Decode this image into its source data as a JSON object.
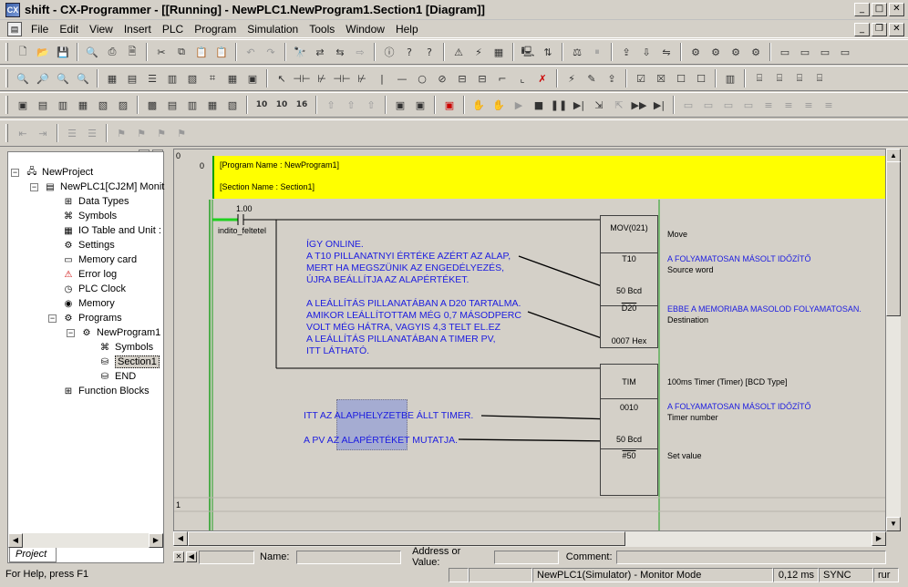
{
  "window": {
    "title": "shift - CX-Programmer - [[Running] - NewPLC1.NewProgram1.Section1 [Diagram]]"
  },
  "menu": [
    "File",
    "Edit",
    "View",
    "Insert",
    "PLC",
    "Program",
    "Simulation",
    "Tools",
    "Window",
    "Help"
  ],
  "tree": {
    "items": [
      {
        "label": "NewProject",
        "level": 0,
        "icon": "project-icon"
      },
      {
        "label": "NewPLC1[CJ2M] Monit",
        "level": 1,
        "icon": "plc-icon"
      },
      {
        "label": "Data Types",
        "level": 2,
        "icon": "datatypes-icon"
      },
      {
        "label": "Symbols",
        "level": 2,
        "icon": "symbols-icon"
      },
      {
        "label": "IO Table and Unit :",
        "level": 2,
        "icon": "iotable-icon"
      },
      {
        "label": "Settings",
        "level": 2,
        "icon": "settings-icon"
      },
      {
        "label": "Memory card",
        "level": 2,
        "icon": "memorycard-icon"
      },
      {
        "label": "Error log",
        "level": 2,
        "icon": "errorlog-icon"
      },
      {
        "label": "PLC Clock",
        "level": 2,
        "icon": "clock-icon"
      },
      {
        "label": "Memory",
        "level": 2,
        "icon": "memory-icon"
      },
      {
        "label": "Programs",
        "level": 2,
        "icon": "programs-icon"
      },
      {
        "label": "NewProgram1",
        "level": 3,
        "icon": "program-icon"
      },
      {
        "label": "Symbols",
        "level": 4,
        "icon": "symbols-icon"
      },
      {
        "label": "Section1",
        "level": 4,
        "icon": "section-icon"
      },
      {
        "label": "END",
        "level": 4,
        "icon": "section-icon"
      },
      {
        "label": "Function Blocks",
        "level": 2,
        "icon": "functionblocks-icon"
      }
    ],
    "tab": "Project"
  },
  "diagram": {
    "rung0_num": "0",
    "rung0_step": "0",
    "rung1_num": "1",
    "program_name": "[Program Name : NewProgram1]",
    "section_name": "[Section Name : Section1]",
    "contact_addr": "1.00",
    "contact_name": "indito_feltetel",
    "mov": {
      "name": "MOV(021)",
      "op1": "T10",
      "op1_val": "50 Bcd",
      "op2": "D20",
      "op2_val": "0007 Hex"
    },
    "mov_comments": {
      "title": "Move",
      "op1_sym": "A FOLYAMATOSAN MÁSOLT IDŐZÍTŐ",
      "op1_desc": "Source word",
      "op2_sym": "EBBE A MEMORIABA MASOLOD FOLYAMATOSAN.",
      "op2_desc": "Destination"
    },
    "tim": {
      "name": "TIM",
      "op1": "0010",
      "op1_val": "50 Bcd",
      "op2": "#50"
    },
    "tim_comments": {
      "title": "100ms Timer (Timer) [BCD Type]",
      "op1_sym": "A FOLYAMATOSAN MÁSOLT IDŐZÍTŐ",
      "op1_desc": "Timer number",
      "op2_desc": "Set value"
    },
    "note1": [
      "ÍGY ONLINE.",
      "A T10 PILLANATNYI ÉRTÉKE AZÉRT AZ ALAP,",
      "MERT HA MEGSZÜNIK AZ ENGEDÉLYEZÉS,",
      "ÚJRA BEÁLLÍTJA AZ ALAPÉRTÉKET.",
      "",
      "A LEÁLLÍTÁS PILLANATÁBAN A D20 TARTALMA.",
      "AMIKOR LEÁLLÍTOTTAM MÉG 0,7 MÁSODPERC",
      "VOLT MÉG HÁTRA, VAGYIS 4,3 TELT EL.EZ",
      "A LEÁLLÍTÁS PILLANATÁBAN A TIMER PV,",
      "ITT LÁTHATÓ."
    ],
    "note2": "ITT AZ ALAPHELYZETBE ÁLLT TIMER.",
    "note3": "A PV AZ ALAPÉRTÉKET MUTATJA."
  },
  "infobar": {
    "name_label": "Name:",
    "address_label": "Address or Value:",
    "comment_label": "Comment:"
  },
  "status": {
    "help": "For Help, press F1",
    "mode": "NewPLC1(Simulator) - Monitor Mode",
    "cycle": "0,12 ms",
    "sync": "SYNC",
    "rung": "rur"
  }
}
